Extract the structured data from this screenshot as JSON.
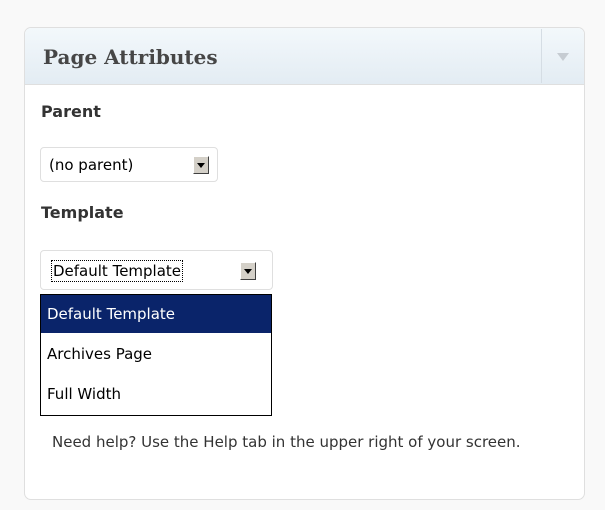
{
  "panel": {
    "title": "Page Attributes",
    "toggle_icon": "triangle-down-icon"
  },
  "parent": {
    "label": "Parent",
    "selected": "(no parent)"
  },
  "template": {
    "label": "Template",
    "selected": "Default Template",
    "options": [
      {
        "label": "Default Template",
        "highlighted": true
      },
      {
        "label": "Archives Page",
        "highlighted": false
      },
      {
        "label": "Full Width",
        "highlighted": false
      }
    ]
  },
  "help": {
    "text": "Need help? Use the Help tab in the upper right of your screen."
  },
  "colors": {
    "highlight_bg": "#0a246a",
    "highlight_text": "#ffffff",
    "header_bg": "#e3ecf3"
  }
}
